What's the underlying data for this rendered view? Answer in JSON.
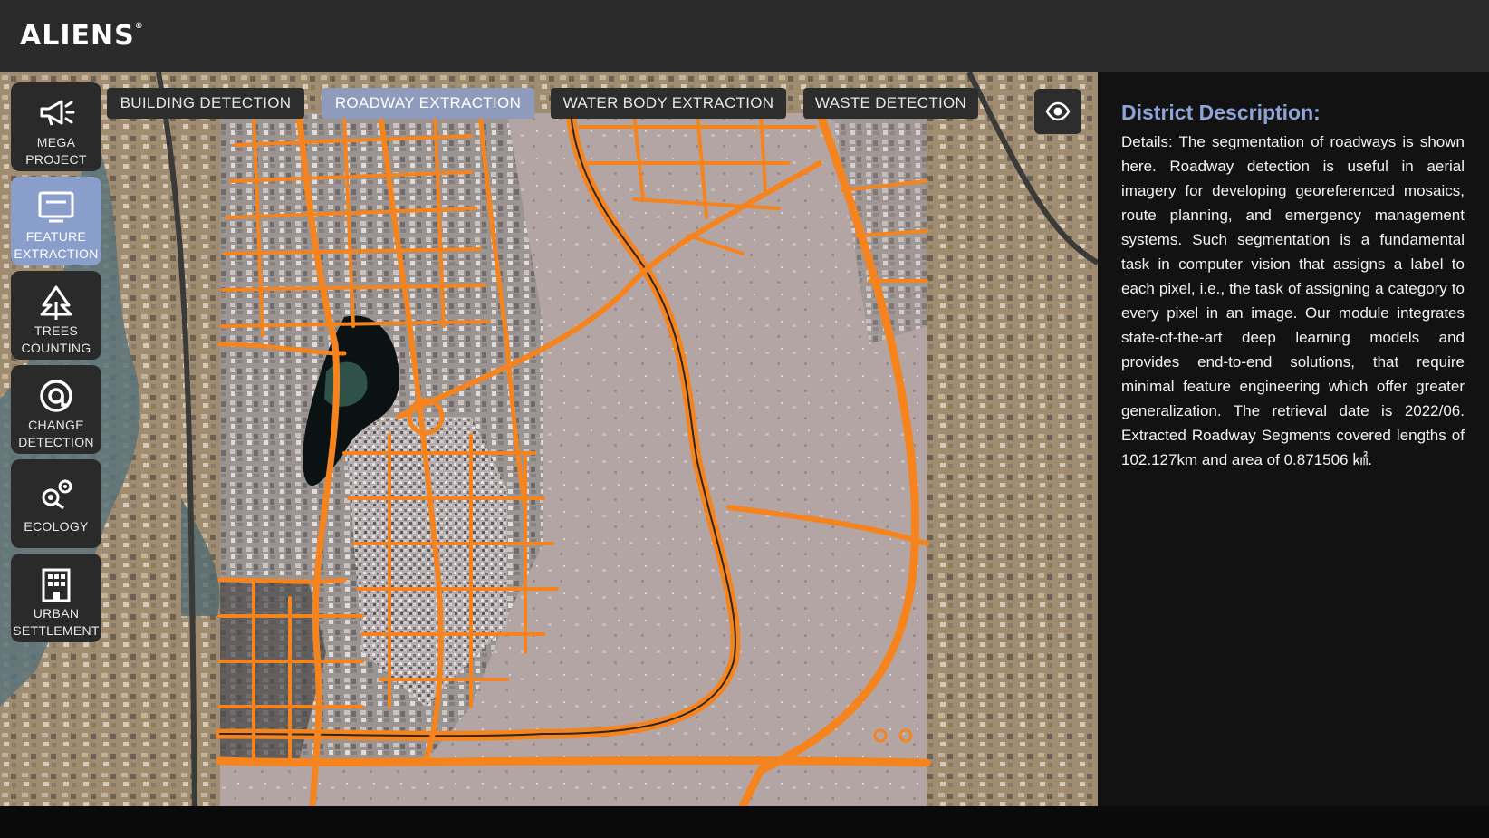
{
  "app": {
    "logo": "ALIENS",
    "logo_mark": "®"
  },
  "sidebar": {
    "items": [
      {
        "line1": "MEGA",
        "line2": "PROJECT",
        "icon": "megaphone-icon"
      },
      {
        "line1": "FEATURE",
        "line2": "EXTRACTION",
        "icon": "monitor-icon",
        "active": true
      },
      {
        "line1": "TREES",
        "line2": "COUNTING",
        "icon": "trees-icon"
      },
      {
        "line1": "CHANGE",
        "line2": "DETECTION",
        "icon": "target-icon"
      },
      {
        "line1": "ECOLOGY",
        "line2": "",
        "icon": "flower-icon"
      },
      {
        "line1": "URBAN",
        "line2": "SETTLEMENT",
        "icon": "building-icon"
      }
    ]
  },
  "tabs": [
    {
      "label": "BUILDING DETECTION",
      "active": false
    },
    {
      "label": "ROADWAY EXTRACTION",
      "active": true
    },
    {
      "label": "WATER BODY EXTRACTION",
      "active": false
    },
    {
      "label": "WASTE DETECTION",
      "active": false
    }
  ],
  "map": {
    "toggle_icon": "eye-icon",
    "overlay_color": "#f5841f"
  },
  "panel": {
    "title": "District Description:",
    "text": "Details: The segmentation of roadways is shown here. Roadway detection is useful in aerial imagery for developing georeferenced mosaics, route planning, and emergency management systems. Such segmentation is a fundamental task in computer vision that assigns a label to each pixel, i.e., the task of assigning a category to every pixel in an image. Our module integrates state-of-the-art deep learning models and provides end-to-end solutions, that require minimal feature engineering which offer greater generalization. The retrieval date is 2022/06. Extracted Roadway Segments covered lengths of 102.127km and area of 0.871506 ㎢."
  },
  "colors": {
    "accent": "#8a9ecb",
    "title": "#8ea4d8",
    "road": "#f5841f"
  }
}
